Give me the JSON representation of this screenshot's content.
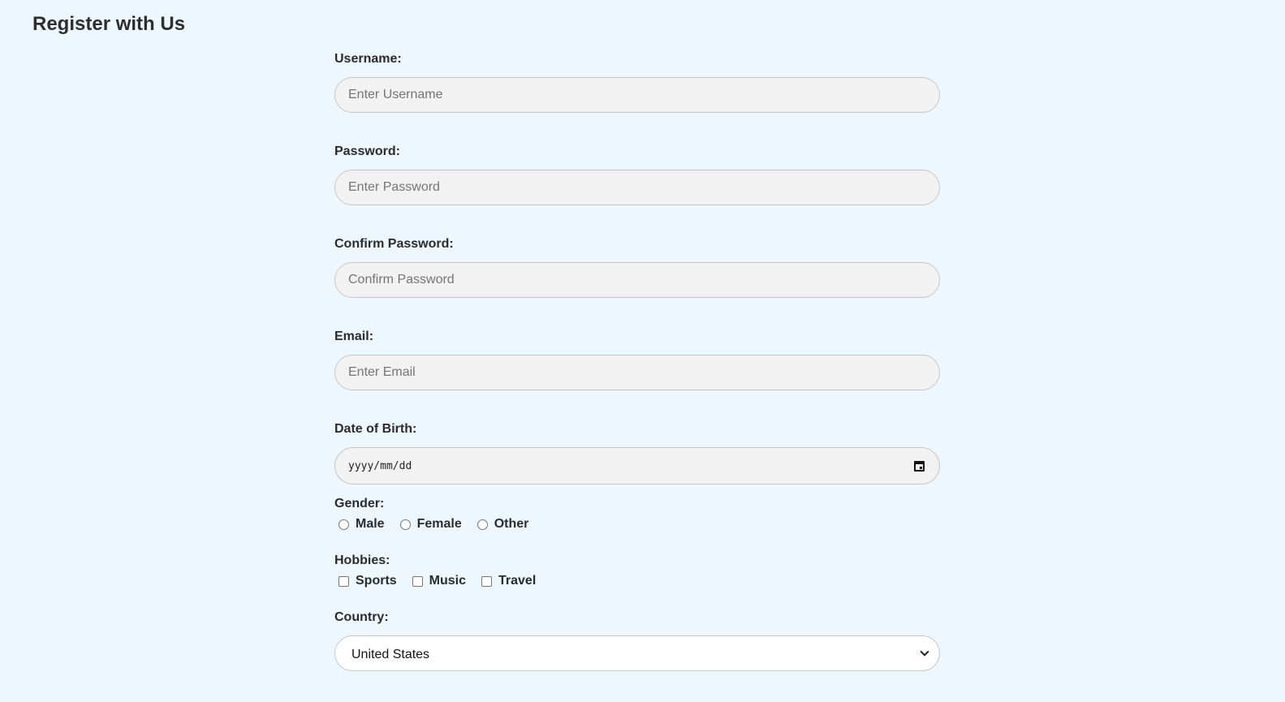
{
  "page": {
    "title": "Register with Us"
  },
  "form": {
    "username": {
      "label": "Username:",
      "placeholder": "Enter Username"
    },
    "password": {
      "label": "Password:",
      "placeholder": "Enter Password"
    },
    "confirm_password": {
      "label": "Confirm Password:",
      "placeholder": "Confirm Password"
    },
    "email": {
      "label": "Email:",
      "placeholder": "Enter Email"
    },
    "dob": {
      "label": "Date of Birth:",
      "placeholder": "yyyy/mm/dd",
      "icon": "calendar-icon"
    },
    "gender": {
      "label": "Gender:",
      "options": [
        "Male",
        "Female",
        "Other"
      ]
    },
    "hobbies": {
      "label": "Hobbies:",
      "options": [
        "Sports",
        "Music",
        "Travel"
      ]
    },
    "country": {
      "label": "Country:",
      "selected": "United States"
    }
  }
}
